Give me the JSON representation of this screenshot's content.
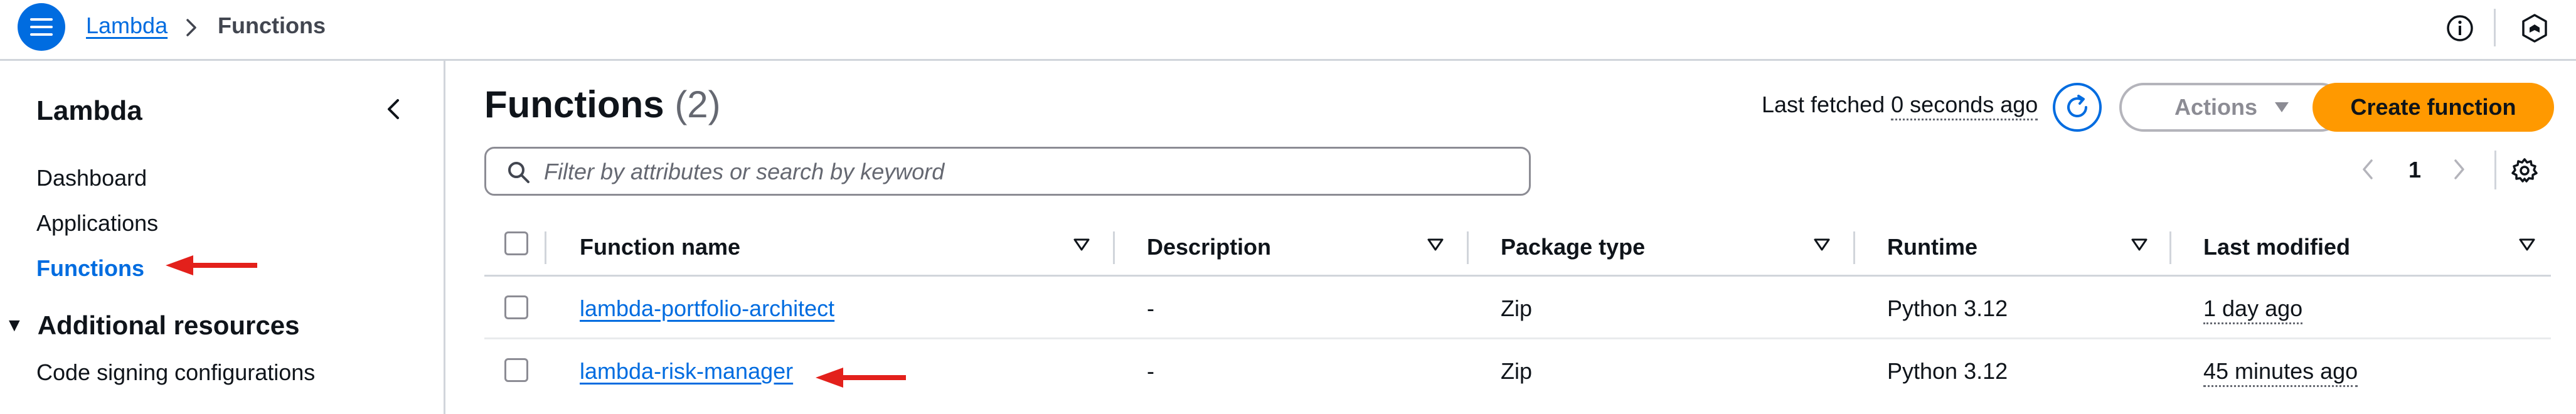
{
  "topbar": {
    "breadcrumb_root": "Lambda",
    "breadcrumb_current": "Functions",
    "icons": [
      "menu-icon",
      "chevron-right-icon",
      "info-icon",
      "notifications-hex-icon"
    ]
  },
  "sidebar": {
    "title": "Lambda",
    "items": [
      {
        "label": "Dashboard",
        "active": false
      },
      {
        "label": "Applications",
        "active": false
      },
      {
        "label": "Functions",
        "active": true
      }
    ],
    "section": {
      "label": "Additional resources",
      "expanded": true
    },
    "section_items": [
      {
        "label": "Code signing configurations"
      }
    ]
  },
  "main": {
    "title": "Functions",
    "count": "(2)",
    "last_fetched_label": "Last fetched",
    "last_fetched_value": "0 seconds ago",
    "actions_label": "Actions",
    "create_label": "Create function",
    "search_placeholder": "Filter by attributes or search by keyword",
    "search_value": "",
    "page": "1"
  },
  "table": {
    "columns": [
      "Function name",
      "Description",
      "Package type",
      "Runtime",
      "Last modified"
    ],
    "rows": [
      {
        "name": "lambda-portfolio-architect",
        "description": "-",
        "package_type": "Zip",
        "runtime": "Python 3.12",
        "last_modified": "1 day ago"
      },
      {
        "name": "lambda-risk-manager",
        "description": "-",
        "package_type": "Zip",
        "runtime": "Python 3.12",
        "last_modified": "45 minutes ago"
      }
    ]
  },
  "colors": {
    "link": "#006ce0",
    "primary_button": "#ff9900",
    "annotation_arrow": "#e3201b",
    "border": "#d1d5db"
  }
}
